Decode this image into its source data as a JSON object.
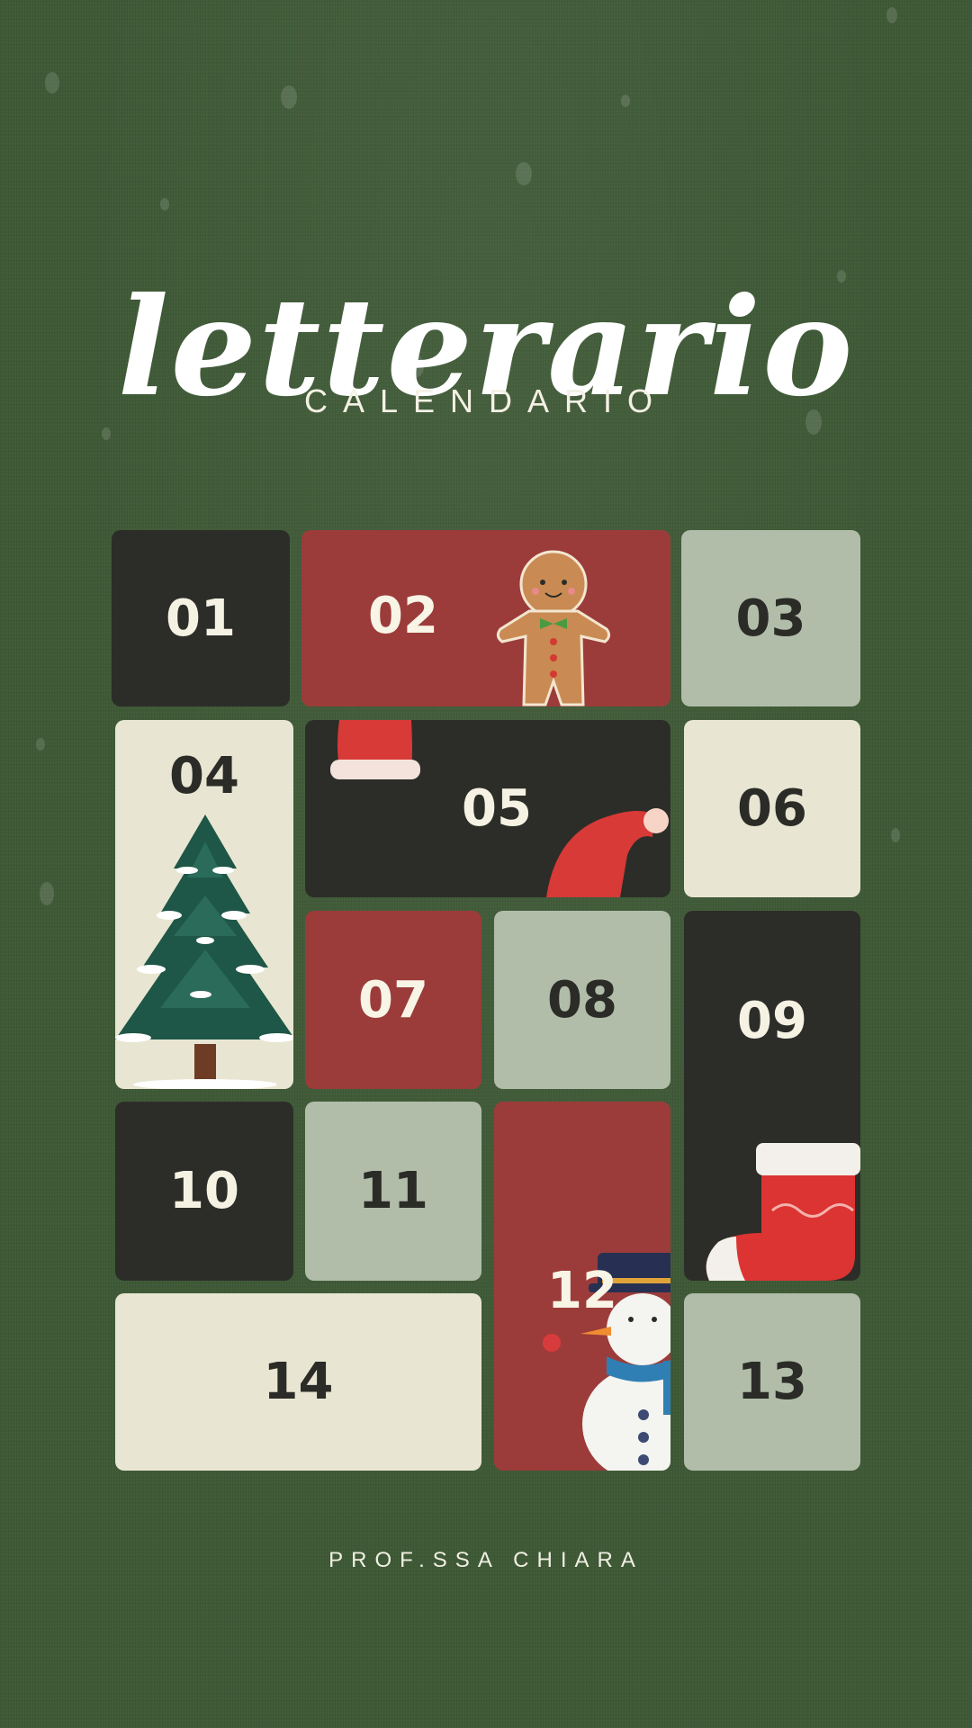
{
  "header": {
    "title": "letterario",
    "subtitle": "CALENDARIO"
  },
  "footer": {
    "author": "PROF.SSA CHIARA"
  },
  "colors": {
    "background": "#3f5a37",
    "dark": "#2c2d28",
    "red": "#9b3c3a",
    "sage": "#b1bda9",
    "cream": "#e8e6d2"
  },
  "tiles": [
    {
      "label": "01",
      "color": "dark",
      "icon": null
    },
    {
      "label": "02",
      "color": "red",
      "icon": "gingerbread-man-icon"
    },
    {
      "label": "03",
      "color": "sage",
      "icon": null
    },
    {
      "label": "04",
      "color": "cream",
      "icon": "christmas-tree-icon"
    },
    {
      "label": "05",
      "color": "dark",
      "icon": "santa-hat-icon"
    },
    {
      "label": "06",
      "color": "cream",
      "icon": null
    },
    {
      "label": "07",
      "color": "red",
      "icon": null
    },
    {
      "label": "08",
      "color": "sage",
      "icon": null
    },
    {
      "label": "09",
      "color": "dark",
      "icon": "christmas-stocking-icon"
    },
    {
      "label": "10",
      "color": "dark",
      "icon": null
    },
    {
      "label": "11",
      "color": "sage",
      "icon": null
    },
    {
      "label": "12",
      "color": "red",
      "icon": "snowman-icon"
    },
    {
      "label": "13",
      "color": "sage",
      "icon": null
    },
    {
      "label": "14",
      "color": "cream",
      "icon": null
    }
  ]
}
